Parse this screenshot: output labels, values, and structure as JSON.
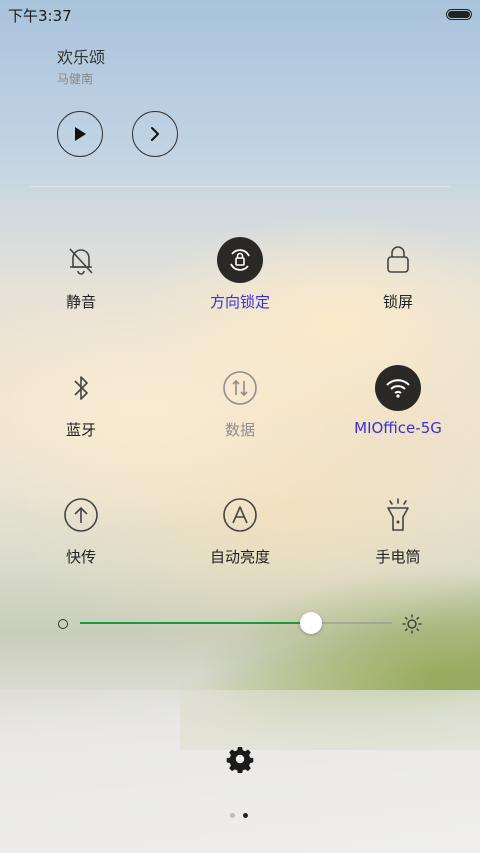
{
  "status_bar": {
    "time": "下午3:37",
    "battery_level": 1.0
  },
  "music": {
    "title": "欢乐颂",
    "artist": "马健南",
    "play_icon": "play-icon",
    "next_icon": "next-icon"
  },
  "toggles": [
    {
      "label": "静音",
      "icon": "bell-off-icon",
      "state": "off"
    },
    {
      "label": "方向锁定",
      "icon": "rotation-lock-icon",
      "state": "on"
    },
    {
      "label": "锁屏",
      "icon": "lock-icon",
      "state": "off"
    },
    {
      "label": "蓝牙",
      "icon": "bluetooth-icon",
      "state": "off"
    },
    {
      "label": "数据",
      "icon": "mobile-data-icon",
      "state": "disabled"
    },
    {
      "label": "MIOffice-5G",
      "icon": "wifi-icon",
      "state": "on"
    },
    {
      "label": "快传",
      "icon": "upload-icon",
      "state": "off"
    },
    {
      "label": "自动亮度",
      "icon": "auto-brightness-icon",
      "state": "off"
    },
    {
      "label": "手电筒",
      "icon": "flashlight-icon",
      "state": "off"
    }
  ],
  "brightness": {
    "level": 0.74,
    "min_icon": "brightness-low-icon",
    "max_icon": "brightness-high-icon"
  },
  "colors": {
    "active_label": "#3b2fd6",
    "active_bg": "#2b2926",
    "slider_fill": "#1a9a3e"
  },
  "settings": {
    "icon": "gear-icon"
  },
  "pager": {
    "pages": 2,
    "current": 2
  }
}
